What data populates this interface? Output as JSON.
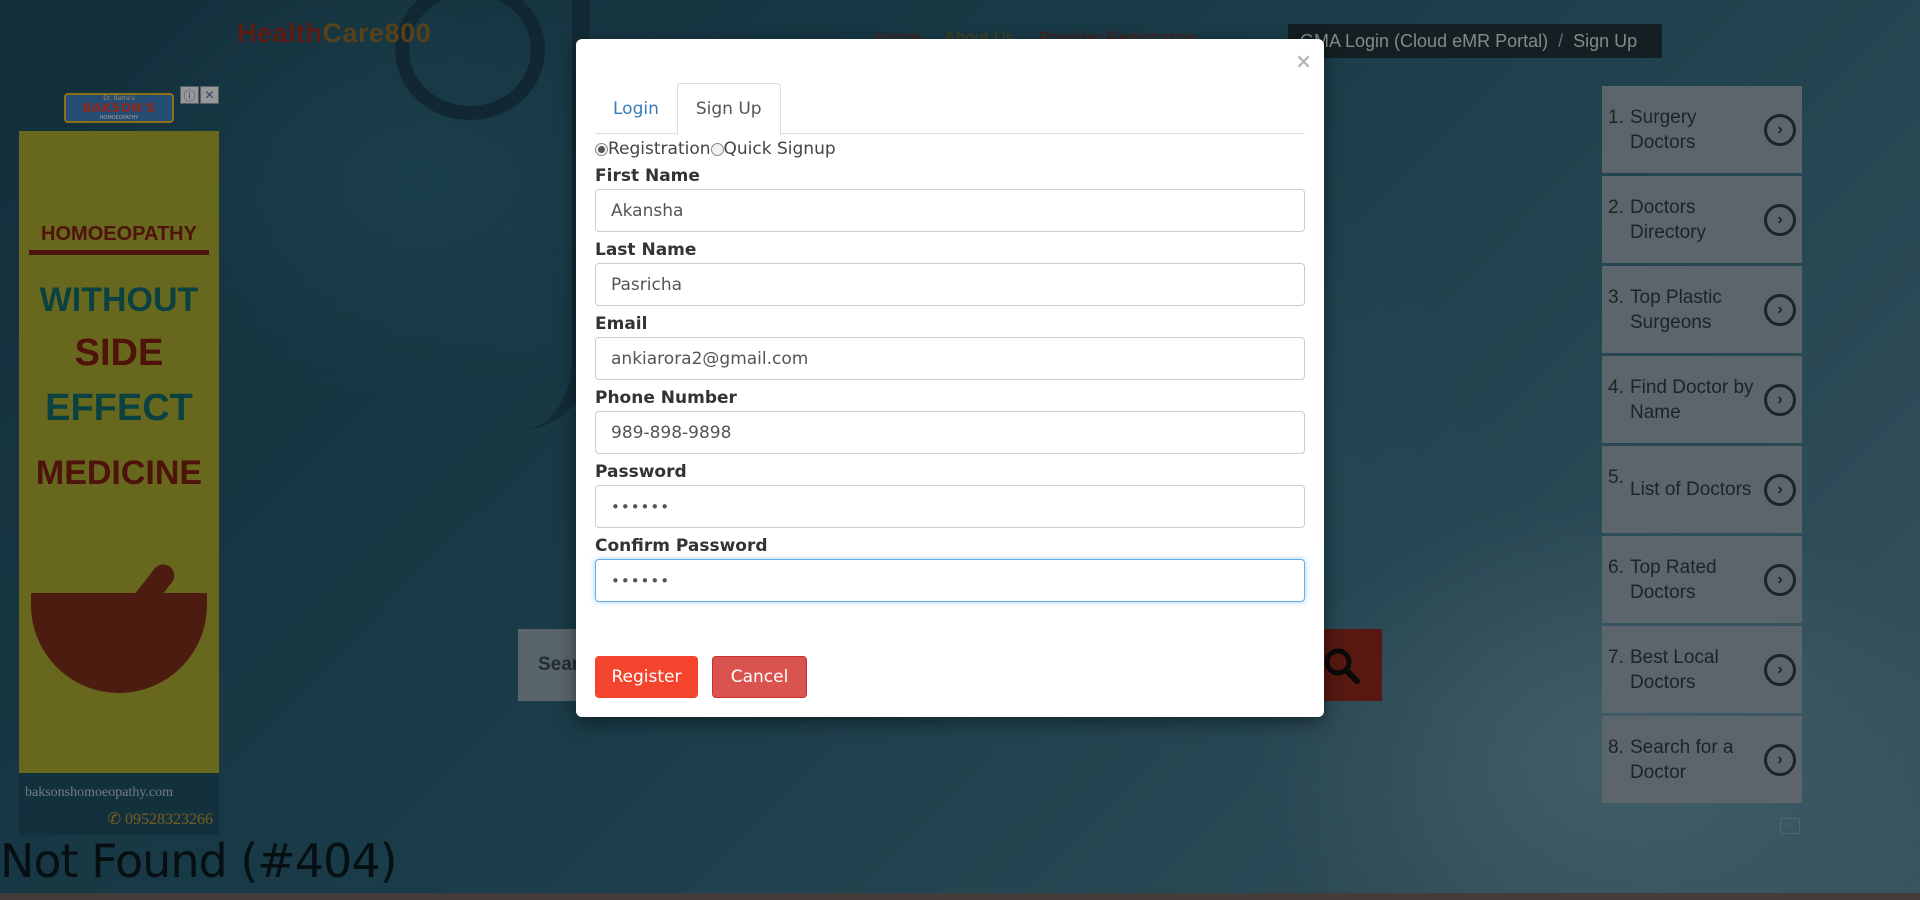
{
  "site": {
    "logo_part1": "Health",
    "logo_part2": "Care800",
    "nav": [
      "Home",
      "About Us",
      "Provider Registration"
    ],
    "account_login": "GMA Login (Cloud eMR Portal)",
    "account_sep": "/",
    "account_signup": "Sign Up"
  },
  "ad": {
    "logo_small": "Dr. Batra's",
    "logo_big": "BAKSON'S",
    "logo_sub": "HOMOEOPATHY",
    "line1": "HOMOEOPATHY",
    "line2": "WITHOUT",
    "line3": "SIDE",
    "line4": "EFFECT",
    "line5": "MEDICINE",
    "site": "baksonshomoeopathy.com",
    "phone": "✆ 09528323266"
  },
  "search": {
    "placeholder": "Sear"
  },
  "page": {
    "error_title": "Not Found (#404)"
  },
  "right_list": [
    {
      "num": "1.",
      "label": "Surgery Doctors"
    },
    {
      "num": "2.",
      "label": "Doctors Directory"
    },
    {
      "num": "3.",
      "label": "Top Plastic Surgeons"
    },
    {
      "num": "4.",
      "label": "Find Doctor by Name"
    },
    {
      "num": "5.",
      "label": "List of Doctors"
    },
    {
      "num": "6.",
      "label": "Top Rated Doctors"
    },
    {
      "num": "7.",
      "label": "Best Local Doctors"
    },
    {
      "num": "8.",
      "label": "Search for a Doctor"
    }
  ],
  "modal": {
    "close": "×",
    "tabs": {
      "login": "Login",
      "signup": "Sign Up"
    },
    "radio": {
      "registration": "Registration",
      "quick_signup": "Quick Signup"
    },
    "fields": {
      "first_name": {
        "label": "First Name",
        "value": "Akansha"
      },
      "last_name": {
        "label": "Last Name",
        "value": "Pasricha"
      },
      "email": {
        "label": "Email",
        "value": "ankiarora2@gmail.com"
      },
      "phone": {
        "label": "Phone Number",
        "value": "989-898-9898"
      },
      "password": {
        "label": "Password",
        "value": "••••••"
      },
      "confirm_password": {
        "label": "Confirm Password",
        "value": "••••••"
      }
    },
    "buttons": {
      "register": "Register",
      "cancel": "Cancel"
    }
  },
  "colors": {
    "register": "#f4442e",
    "cancel": "#d9534f",
    "tab_link": "#3a7ab8",
    "focus": "#66afe9"
  }
}
